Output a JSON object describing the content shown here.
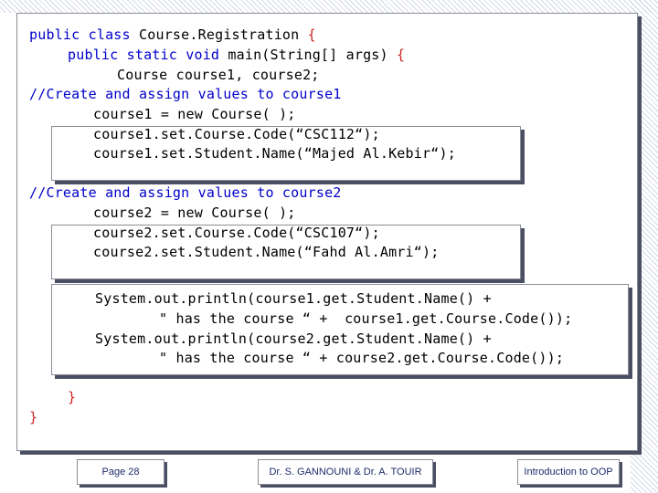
{
  "code": {
    "l1_kw": "public class",
    "l1_rest": " Course.Registration",
    "l1_brace": " {",
    "l2_kw": "public static void",
    "l2_rest": " main(String[] args)",
    "l2_brace": " {",
    "l3": "Course course1, course2;",
    "c1": "//Create and assign values to course1",
    "l4": "course1 = new Course( );",
    "l5": "course1.set.Course.Code(“CSC112“);",
    "l6": "course1.set.Student.Name(“Majed Al.Kebir“);",
    "c2": "//Create and assign values to course2",
    "l7": "course2 = new Course( );",
    "l8": "course2.set.Course.Code(“CSC107“);",
    "l9": "course2.set.Student.Name(“Fahd Al.Amri“);",
    "l10": "System.out.println(course1.get.Student.Name() +",
    "l11": "\" has the course “ +  course1.get.Course.Code());",
    "l12": "System.out.println(course2.get.Student.Name() +",
    "l13": "\" has the course “ + course2.get.Course.Code());",
    "close_inner": "}",
    "close_outer": "}"
  },
  "footer": {
    "page": "Page 28",
    "authors": "Dr. S. GANNOUNI & Dr. A. TOUIR",
    "course": "Introduction to OOP"
  }
}
